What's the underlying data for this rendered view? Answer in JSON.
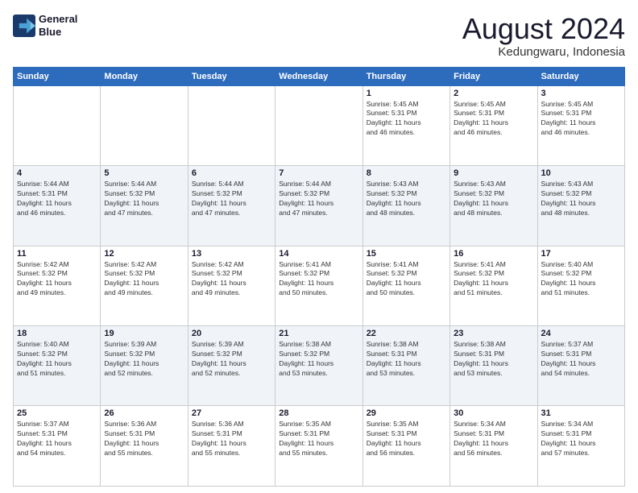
{
  "header": {
    "logo_line1": "General",
    "logo_line2": "Blue",
    "month_title": "August 2024",
    "location": "Kedungwaru, Indonesia"
  },
  "weekdays": [
    "Sunday",
    "Monday",
    "Tuesday",
    "Wednesday",
    "Thursday",
    "Friday",
    "Saturday"
  ],
  "weeks": [
    [
      {
        "day": "",
        "info": ""
      },
      {
        "day": "",
        "info": ""
      },
      {
        "day": "",
        "info": ""
      },
      {
        "day": "",
        "info": ""
      },
      {
        "day": "1",
        "info": "Sunrise: 5:45 AM\nSunset: 5:31 PM\nDaylight: 11 hours\nand 46 minutes."
      },
      {
        "day": "2",
        "info": "Sunrise: 5:45 AM\nSunset: 5:31 PM\nDaylight: 11 hours\nand 46 minutes."
      },
      {
        "day": "3",
        "info": "Sunrise: 5:45 AM\nSunset: 5:31 PM\nDaylight: 11 hours\nand 46 minutes."
      }
    ],
    [
      {
        "day": "4",
        "info": "Sunrise: 5:44 AM\nSunset: 5:31 PM\nDaylight: 11 hours\nand 46 minutes."
      },
      {
        "day": "5",
        "info": "Sunrise: 5:44 AM\nSunset: 5:32 PM\nDaylight: 11 hours\nand 47 minutes."
      },
      {
        "day": "6",
        "info": "Sunrise: 5:44 AM\nSunset: 5:32 PM\nDaylight: 11 hours\nand 47 minutes."
      },
      {
        "day": "7",
        "info": "Sunrise: 5:44 AM\nSunset: 5:32 PM\nDaylight: 11 hours\nand 47 minutes."
      },
      {
        "day": "8",
        "info": "Sunrise: 5:43 AM\nSunset: 5:32 PM\nDaylight: 11 hours\nand 48 minutes."
      },
      {
        "day": "9",
        "info": "Sunrise: 5:43 AM\nSunset: 5:32 PM\nDaylight: 11 hours\nand 48 minutes."
      },
      {
        "day": "10",
        "info": "Sunrise: 5:43 AM\nSunset: 5:32 PM\nDaylight: 11 hours\nand 48 minutes."
      }
    ],
    [
      {
        "day": "11",
        "info": "Sunrise: 5:42 AM\nSunset: 5:32 PM\nDaylight: 11 hours\nand 49 minutes."
      },
      {
        "day": "12",
        "info": "Sunrise: 5:42 AM\nSunset: 5:32 PM\nDaylight: 11 hours\nand 49 minutes."
      },
      {
        "day": "13",
        "info": "Sunrise: 5:42 AM\nSunset: 5:32 PM\nDaylight: 11 hours\nand 49 minutes."
      },
      {
        "day": "14",
        "info": "Sunrise: 5:41 AM\nSunset: 5:32 PM\nDaylight: 11 hours\nand 50 minutes."
      },
      {
        "day": "15",
        "info": "Sunrise: 5:41 AM\nSunset: 5:32 PM\nDaylight: 11 hours\nand 50 minutes."
      },
      {
        "day": "16",
        "info": "Sunrise: 5:41 AM\nSunset: 5:32 PM\nDaylight: 11 hours\nand 51 minutes."
      },
      {
        "day": "17",
        "info": "Sunrise: 5:40 AM\nSunset: 5:32 PM\nDaylight: 11 hours\nand 51 minutes."
      }
    ],
    [
      {
        "day": "18",
        "info": "Sunrise: 5:40 AM\nSunset: 5:32 PM\nDaylight: 11 hours\nand 51 minutes."
      },
      {
        "day": "19",
        "info": "Sunrise: 5:39 AM\nSunset: 5:32 PM\nDaylight: 11 hours\nand 52 minutes."
      },
      {
        "day": "20",
        "info": "Sunrise: 5:39 AM\nSunset: 5:32 PM\nDaylight: 11 hours\nand 52 minutes."
      },
      {
        "day": "21",
        "info": "Sunrise: 5:38 AM\nSunset: 5:32 PM\nDaylight: 11 hours\nand 53 minutes."
      },
      {
        "day": "22",
        "info": "Sunrise: 5:38 AM\nSunset: 5:31 PM\nDaylight: 11 hours\nand 53 minutes."
      },
      {
        "day": "23",
        "info": "Sunrise: 5:38 AM\nSunset: 5:31 PM\nDaylight: 11 hours\nand 53 minutes."
      },
      {
        "day": "24",
        "info": "Sunrise: 5:37 AM\nSunset: 5:31 PM\nDaylight: 11 hours\nand 54 minutes."
      }
    ],
    [
      {
        "day": "25",
        "info": "Sunrise: 5:37 AM\nSunset: 5:31 PM\nDaylight: 11 hours\nand 54 minutes."
      },
      {
        "day": "26",
        "info": "Sunrise: 5:36 AM\nSunset: 5:31 PM\nDaylight: 11 hours\nand 55 minutes."
      },
      {
        "day": "27",
        "info": "Sunrise: 5:36 AM\nSunset: 5:31 PM\nDaylight: 11 hours\nand 55 minutes."
      },
      {
        "day": "28",
        "info": "Sunrise: 5:35 AM\nSunset: 5:31 PM\nDaylight: 11 hours\nand 55 minutes."
      },
      {
        "day": "29",
        "info": "Sunrise: 5:35 AM\nSunset: 5:31 PM\nDaylight: 11 hours\nand 56 minutes."
      },
      {
        "day": "30",
        "info": "Sunrise: 5:34 AM\nSunset: 5:31 PM\nDaylight: 11 hours\nand 56 minutes."
      },
      {
        "day": "31",
        "info": "Sunrise: 5:34 AM\nSunset: 5:31 PM\nDaylight: 11 hours\nand 57 minutes."
      }
    ]
  ]
}
